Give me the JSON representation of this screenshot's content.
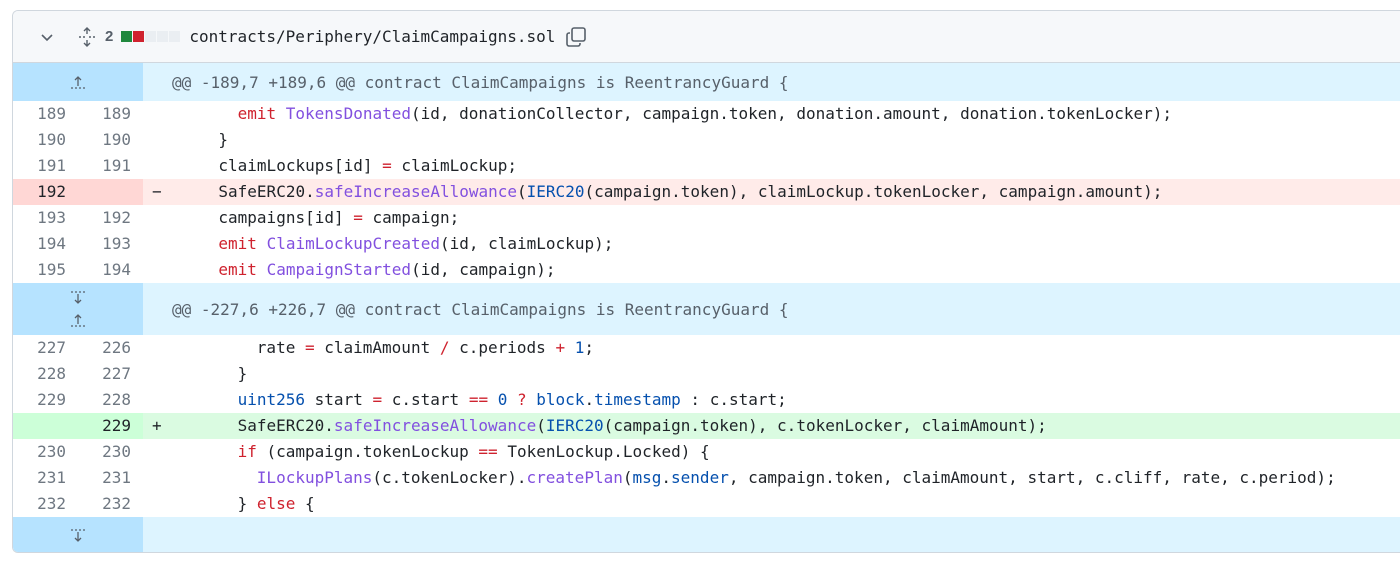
{
  "file": {
    "change_count": "2",
    "name": "contracts/Periphery/ClaimCampaigns.sol",
    "diffstat": [
      "add",
      "del",
      "neutral",
      "neutral",
      "neutral"
    ]
  },
  "hunks": [
    {
      "header": "@@ -189,7 +189,6 @@ contract ClaimCampaigns is ReentrancyGuard {",
      "lines": [
        {
          "type": "ctx",
          "old": "189",
          "new": "189",
          "marker": "",
          "indent": 6,
          "tokens": [
            [
              "kw",
              "emit"
            ],
            [
              "t",
              " "
            ],
            [
              "fn",
              "TokensDonated"
            ],
            [
              "t",
              "(id, donationCollector, campaign.token, donation.amount, donation.tokenLocker);"
            ]
          ]
        },
        {
          "type": "ctx",
          "old": "190",
          "new": "190",
          "marker": "",
          "indent": 4,
          "tokens": [
            [
              "t",
              "}"
            ]
          ]
        },
        {
          "type": "ctx",
          "old": "191",
          "new": "191",
          "marker": "",
          "indent": 4,
          "tokens": [
            [
              "t",
              "claimLockups[id] "
            ],
            [
              "op",
              "="
            ],
            [
              "t",
              " claimLockup;"
            ]
          ]
        },
        {
          "type": "del",
          "old": "192",
          "new": "",
          "marker": "−",
          "indent": 4,
          "tokens": [
            [
              "t",
              "SafeERC20."
            ],
            [
              "fn",
              "safeIncreaseAllowance"
            ],
            [
              "t",
              "("
            ],
            [
              "ty",
              "IERC20"
            ],
            [
              "t",
              "(campaign.token), claimLockup.tokenLocker, campaign.amount);"
            ]
          ]
        },
        {
          "type": "ctx",
          "old": "193",
          "new": "192",
          "marker": "",
          "indent": 4,
          "tokens": [
            [
              "t",
              "campaigns[id] "
            ],
            [
              "op",
              "="
            ],
            [
              "t",
              " campaign;"
            ]
          ]
        },
        {
          "type": "ctx",
          "old": "194",
          "new": "193",
          "marker": "",
          "indent": 4,
          "tokens": [
            [
              "kw",
              "emit"
            ],
            [
              "t",
              " "
            ],
            [
              "fn",
              "ClaimLockupCreated"
            ],
            [
              "t",
              "(id, claimLockup);"
            ]
          ]
        },
        {
          "type": "ctx",
          "old": "195",
          "new": "194",
          "marker": "",
          "indent": 4,
          "tokens": [
            [
              "kw",
              "emit"
            ],
            [
              "t",
              " "
            ],
            [
              "fn",
              "CampaignStarted"
            ],
            [
              "t",
              "(id, campaign);"
            ]
          ]
        }
      ]
    },
    {
      "header": "@@ -227,6 +226,7 @@ contract ClaimCampaigns is ReentrancyGuard {",
      "lines": [
        {
          "type": "ctx",
          "old": "227",
          "new": "226",
          "marker": "",
          "indent": 8,
          "tokens": [
            [
              "t",
              "rate "
            ],
            [
              "op",
              "="
            ],
            [
              "t",
              " claimAmount "
            ],
            [
              "op",
              "/"
            ],
            [
              "t",
              " c.periods "
            ],
            [
              "op",
              "+"
            ],
            [
              "t",
              " "
            ],
            [
              "num",
              "1"
            ],
            [
              "t",
              ";"
            ]
          ]
        },
        {
          "type": "ctx",
          "old": "228",
          "new": "227",
          "marker": "",
          "indent": 6,
          "tokens": [
            [
              "t",
              "}"
            ]
          ]
        },
        {
          "type": "ctx",
          "old": "229",
          "new": "228",
          "marker": "",
          "indent": 6,
          "tokens": [
            [
              "ty",
              "uint256"
            ],
            [
              "t",
              " start "
            ],
            [
              "op",
              "="
            ],
            [
              "t",
              " c.start "
            ],
            [
              "op",
              "=="
            ],
            [
              "t",
              " "
            ],
            [
              "num",
              "0"
            ],
            [
              "t",
              " "
            ],
            [
              "op",
              "?"
            ],
            [
              "t",
              " "
            ],
            [
              "ty",
              "block"
            ],
            [
              "t",
              "."
            ],
            [
              "ty",
              "timestamp"
            ],
            [
              "t",
              " : c.start;"
            ]
          ]
        },
        {
          "type": "add",
          "old": "",
          "new": "229",
          "marker": "+",
          "indent": 6,
          "tokens": [
            [
              "t",
              "SafeERC20."
            ],
            [
              "fn",
              "safeIncreaseAllowance"
            ],
            [
              "t",
              "("
            ],
            [
              "ty",
              "IERC20"
            ],
            [
              "t",
              "(campaign.token), c.tokenLocker, claimAmount);"
            ]
          ]
        },
        {
          "type": "ctx",
          "old": "230",
          "new": "230",
          "marker": "",
          "indent": 6,
          "tokens": [
            [
              "kw",
              "if"
            ],
            [
              "t",
              " (campaign.tokenLockup "
            ],
            [
              "op",
              "=="
            ],
            [
              "t",
              " TokenLockup.Locked) {"
            ]
          ]
        },
        {
          "type": "ctx",
          "old": "231",
          "new": "231",
          "marker": "",
          "indent": 8,
          "tokens": [
            [
              "fn",
              "ILockupPlans"
            ],
            [
              "t",
              "(c.tokenLocker)."
            ],
            [
              "fn",
              "createPlan"
            ],
            [
              "t",
              "("
            ],
            [
              "ty",
              "msg"
            ],
            [
              "t",
              "."
            ],
            [
              "ty",
              "sender"
            ],
            [
              "t",
              ", campaign.token, claimAmount, start, c.cliff, rate, c.period);"
            ]
          ]
        },
        {
          "type": "ctx",
          "old": "232",
          "new": "232",
          "marker": "",
          "indent": 6,
          "tokens": [
            [
              "t",
              "} "
            ],
            [
              "kw",
              "else"
            ],
            [
              "t",
              " {"
            ]
          ]
        }
      ]
    }
  ]
}
